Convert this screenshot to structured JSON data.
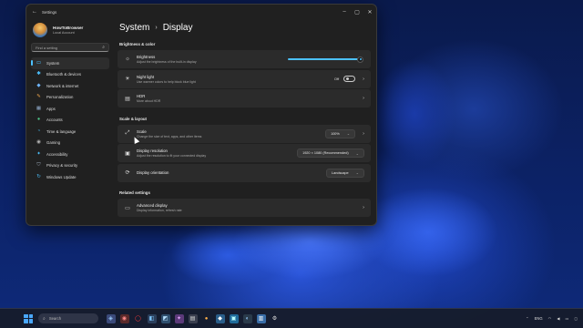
{
  "window": {
    "title": "Settings",
    "back_icon": "back-arrow-icon",
    "controls": [
      "minimize-icon",
      "maximize-icon",
      "close-icon"
    ]
  },
  "profile": {
    "name": "HowToBrowser",
    "account": "Local Account"
  },
  "search": {
    "placeholder": "Find a setting"
  },
  "sidebar": {
    "items": [
      {
        "label": "System",
        "icon": "monitor-icon",
        "active": true
      },
      {
        "label": "Bluetooth & devices",
        "icon": "bluetooth-icon"
      },
      {
        "label": "Network & internet",
        "icon": "network-icon"
      },
      {
        "label": "Personalization",
        "icon": "brush-icon"
      },
      {
        "label": "Apps",
        "icon": "apps-icon"
      },
      {
        "label": "Accounts",
        "icon": "person-icon"
      },
      {
        "label": "Time & language",
        "icon": "globe-clock-icon"
      },
      {
        "label": "Gaming",
        "icon": "gamepad-icon"
      },
      {
        "label": "Accessibility",
        "icon": "accessibility-icon"
      },
      {
        "label": "Privacy & security",
        "icon": "shield-icon"
      },
      {
        "label": "Windows Update",
        "icon": "update-icon"
      }
    ]
  },
  "breadcrumb": {
    "parent": "System",
    "current": "Display"
  },
  "sections": {
    "brightness_color": "Brightness & color",
    "scale_layout": "Scale & layout",
    "related": "Related settings"
  },
  "settings": {
    "brightness": {
      "title": "Brightness",
      "desc": "Adjust the brightness of the built-in display",
      "level": 1.0
    },
    "night_light": {
      "title": "Night light",
      "desc": "Use warmer colors to help block blue light",
      "state": "Off"
    },
    "hdr": {
      "title": "HDR",
      "desc": "More about HDR"
    },
    "scale": {
      "title": "Scale",
      "desc": "Change the size of text, apps, and other items",
      "value": "100%"
    },
    "resolution": {
      "title": "Display resolution",
      "desc": "Adjust the resolution to fit your connected display",
      "value": "1920 × 1080 (Recommended)"
    },
    "orientation": {
      "title": "Display orientation",
      "value": "Landscape"
    },
    "advanced": {
      "title": "Advanced display",
      "desc": "Display information, refresh rate"
    }
  },
  "taskbar": {
    "search_placeholder": "Search",
    "lang": "ENG",
    "colors": {
      "accent": "#4cc2ff",
      "window_bg": "#202020",
      "card_bg": "#2b2b2b"
    }
  }
}
